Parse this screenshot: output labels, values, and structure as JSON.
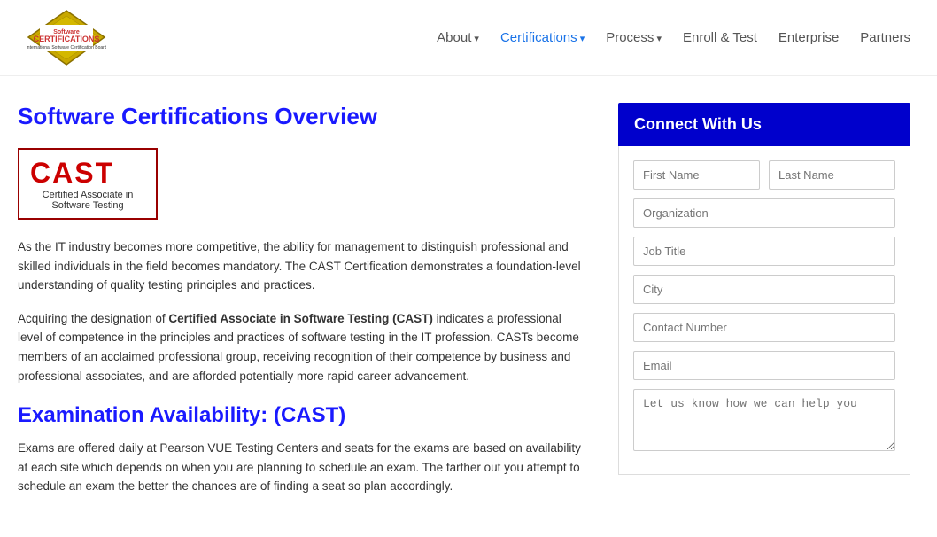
{
  "header": {
    "logo_alt": "Software Certifications",
    "nav_items": [
      {
        "label": "About",
        "has_arrow": true,
        "active": false
      },
      {
        "label": "Certifications",
        "has_arrow": true,
        "active": true
      },
      {
        "label": "Process",
        "has_arrow": true,
        "active": false
      },
      {
        "label": "Enroll & Test",
        "has_arrow": false,
        "active": false
      },
      {
        "label": "Enterprise",
        "has_arrow": false,
        "active": false
      },
      {
        "label": "Partners",
        "has_arrow": false,
        "active": false
      }
    ]
  },
  "main": {
    "page_title": "Software Certifications Overview",
    "cast_title": "CAST",
    "cast_subtitle": "Certified Associate in Software Testing",
    "paragraph1": "As the IT industry becomes more competitive, the ability for management to distinguish professional and skilled individuals in the field becomes mandatory. The CAST Certification demonstrates a foundation-level understanding of quality testing principles and practices.",
    "paragraph2_prefix": "Acquiring the designation of ",
    "paragraph2_bold": "Certified Associate in Software Testing (CAST)",
    "paragraph2_suffix": " indicates a professional level of competence in the principles and practices of software testing in the IT profession. CASTs become members of an acclaimed professional group, receiving recognition of their competence by business and professional associates, and are afforded potentially more rapid career advancement.",
    "section2_title": "Examination Availability: (CAST)",
    "paragraph3": "Exams are offered daily at Pearson VUE Testing Centers and seats for the exams are based on availability at each site which depends on when you are planning to schedule an exam. The farther out you attempt to schedule an exam the better the chances are of finding a seat so plan accordingly."
  },
  "sidebar": {
    "connect_title": "Connect With Us",
    "form": {
      "first_name_placeholder": "First Name",
      "last_name_placeholder": "Last Name",
      "organization_placeholder": "Organization",
      "job_title_placeholder": "Job Title",
      "city_placeholder": "City",
      "contact_number_placeholder": "Contact Number",
      "email_placeholder": "Email",
      "message_placeholder": "Let us know how we can help you"
    }
  }
}
